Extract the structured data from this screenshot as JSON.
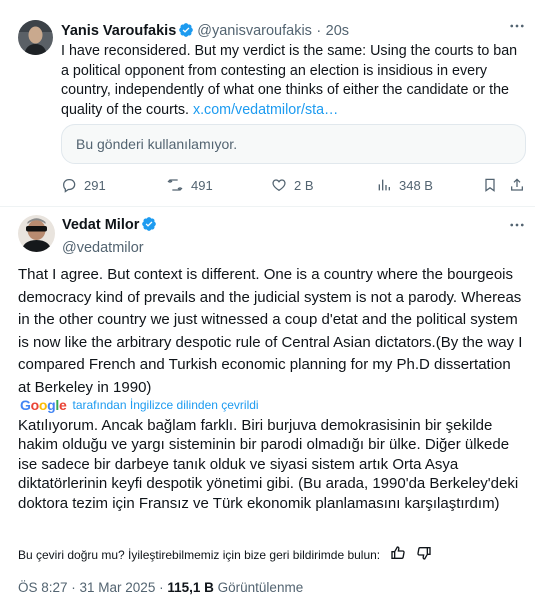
{
  "reply_tweet": {
    "author_name": "Yanis Varoufakis",
    "handle": "@yanisvaroufakis",
    "separator": "·",
    "time": "20s",
    "text": "I have reconsidered. But my verdict is the same: Using the courts to ban a political opponent from contesting an election is insidious in every country, independently of what one thinks of either the candidate or the quality of the courts.",
    "link_text": "x.com/vedatmilor/sta…",
    "unavailable_card": "Bu gönderi kullanılamıyor.",
    "stats": {
      "replies": "291",
      "reposts": "491",
      "likes": "2 B",
      "views": "348 B"
    }
  },
  "main_tweet": {
    "author_name": "Vedat Milor",
    "handle": "@vedatmilor",
    "text": "That I agree. But context is different. One is a country where the bourgeois democracy kind of prevails and the judicial system is not a parody. Whereas in the other country we just witnessed a coup d'etat and the political system is now like the arbitrary despotic rule of Central Asian dictators.(By the way I compared French and Turkish economic planning for my Ph.D dissertation at Berkeley in 1990)",
    "translated_by": "tarafından İngilizce dilinden çevrildi",
    "translation_provider": "Google",
    "translation": "Katılıyorum. Ancak bağlam farklı. Biri burjuva demokrasisinin bir şekilde hakim olduğu ve yargı sisteminin bir parodi olmadığı bir ülke. Diğer ülkede ise sadece bir darbeye tanık olduk ve siyasi sistem artık Orta Asya diktatörlerinin keyfi despotik yönetimi gibi. (Bu arada, 1990'da Berkeley'deki doktora tezim için Fransız ve Türk ekonomik planlamasını karşılaştırdım)",
    "feedback_prompt": "Bu çeviri doğru mu? İyileştirebilmemiz için bize geri bildirimde bulun:",
    "timestamp": "ÖS 8:27 · 31 Mar 2025 ·",
    "views_count": "115,1 B",
    "views_label": "Görüntülenme"
  },
  "colors": {
    "accent": "#1d9bf0",
    "secondary_text": "#536471",
    "primary_text": "#0f1419",
    "verified": "#1d9bf0"
  },
  "icons": {
    "verified": "verified-badge-icon",
    "more": "more-horizontal-icon",
    "reply": "reply-icon",
    "repost": "repost-icon",
    "like": "heart-icon",
    "views": "analytics-icon",
    "bookmark": "bookmark-icon",
    "share": "share-icon",
    "thumbs_up": "thumbs-up-icon",
    "thumbs_down": "thumbs-down-icon"
  }
}
